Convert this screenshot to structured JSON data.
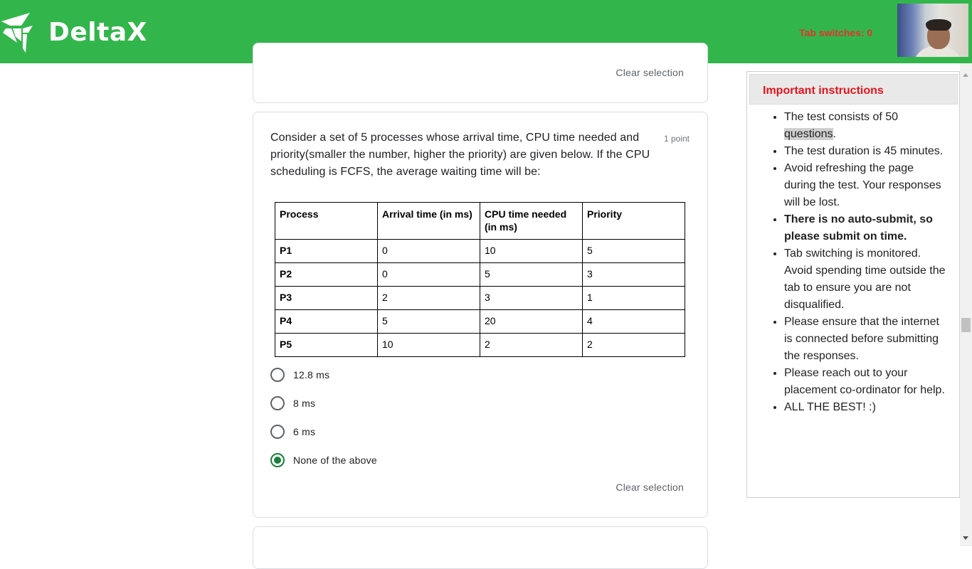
{
  "header": {
    "brand": "DeltaX",
    "tab_switches": "Tab switches: 0",
    "brand_color": "#32b64b"
  },
  "prev_card": {
    "clear_selection": "Clear selection"
  },
  "question_card": {
    "text": "Consider a set of 5 processes whose arrival time, CPU time needed and priority(smaller the number, higher the priority) are given below. If the CPU scheduling is FCFS, the average waiting time will be:",
    "points": "1 point",
    "table": {
      "headers": [
        "Process",
        "Arrival time (in ms)",
        "CPU time needed (in ms)",
        "Priority"
      ],
      "rows": [
        [
          "P1",
          "0",
          "10",
          "5"
        ],
        [
          "P2",
          "0",
          "5",
          "3"
        ],
        [
          "P3",
          "2",
          "3",
          "1"
        ],
        [
          "P4",
          "5",
          "20",
          "4"
        ],
        [
          "P5",
          "10",
          "2",
          "2"
        ]
      ]
    },
    "options": [
      {
        "label": "12.8 ms",
        "selected": false
      },
      {
        "label": "8 ms",
        "selected": false
      },
      {
        "label": "6 ms",
        "selected": false
      },
      {
        "label": "None of the above",
        "selected": true
      }
    ],
    "clear_selection": "Clear selection",
    "accent_color": "#188038"
  },
  "instructions": {
    "title": "Important instructions",
    "items": [
      {
        "pre": "The test consists of 50 ",
        "highlight": "questions",
        "post": "."
      },
      {
        "text": "The test duration is 45 minutes."
      },
      {
        "text": "Avoid refreshing the page during the test. Your responses will be lost."
      },
      {
        "text": "There is no auto-submit, so please submit on time."
      },
      {
        "text": "Tab switching is monitored. Avoid spending time outside the tab to ensure you are not disqualified."
      },
      {
        "text": "Please ensure that the internet is connected before submitting the responses."
      },
      {
        "text": "Please reach out to your placement co-ordinator for help."
      },
      {
        "text": "ALL THE BEST! :)"
      }
    ],
    "title_color": "#e5141d"
  }
}
